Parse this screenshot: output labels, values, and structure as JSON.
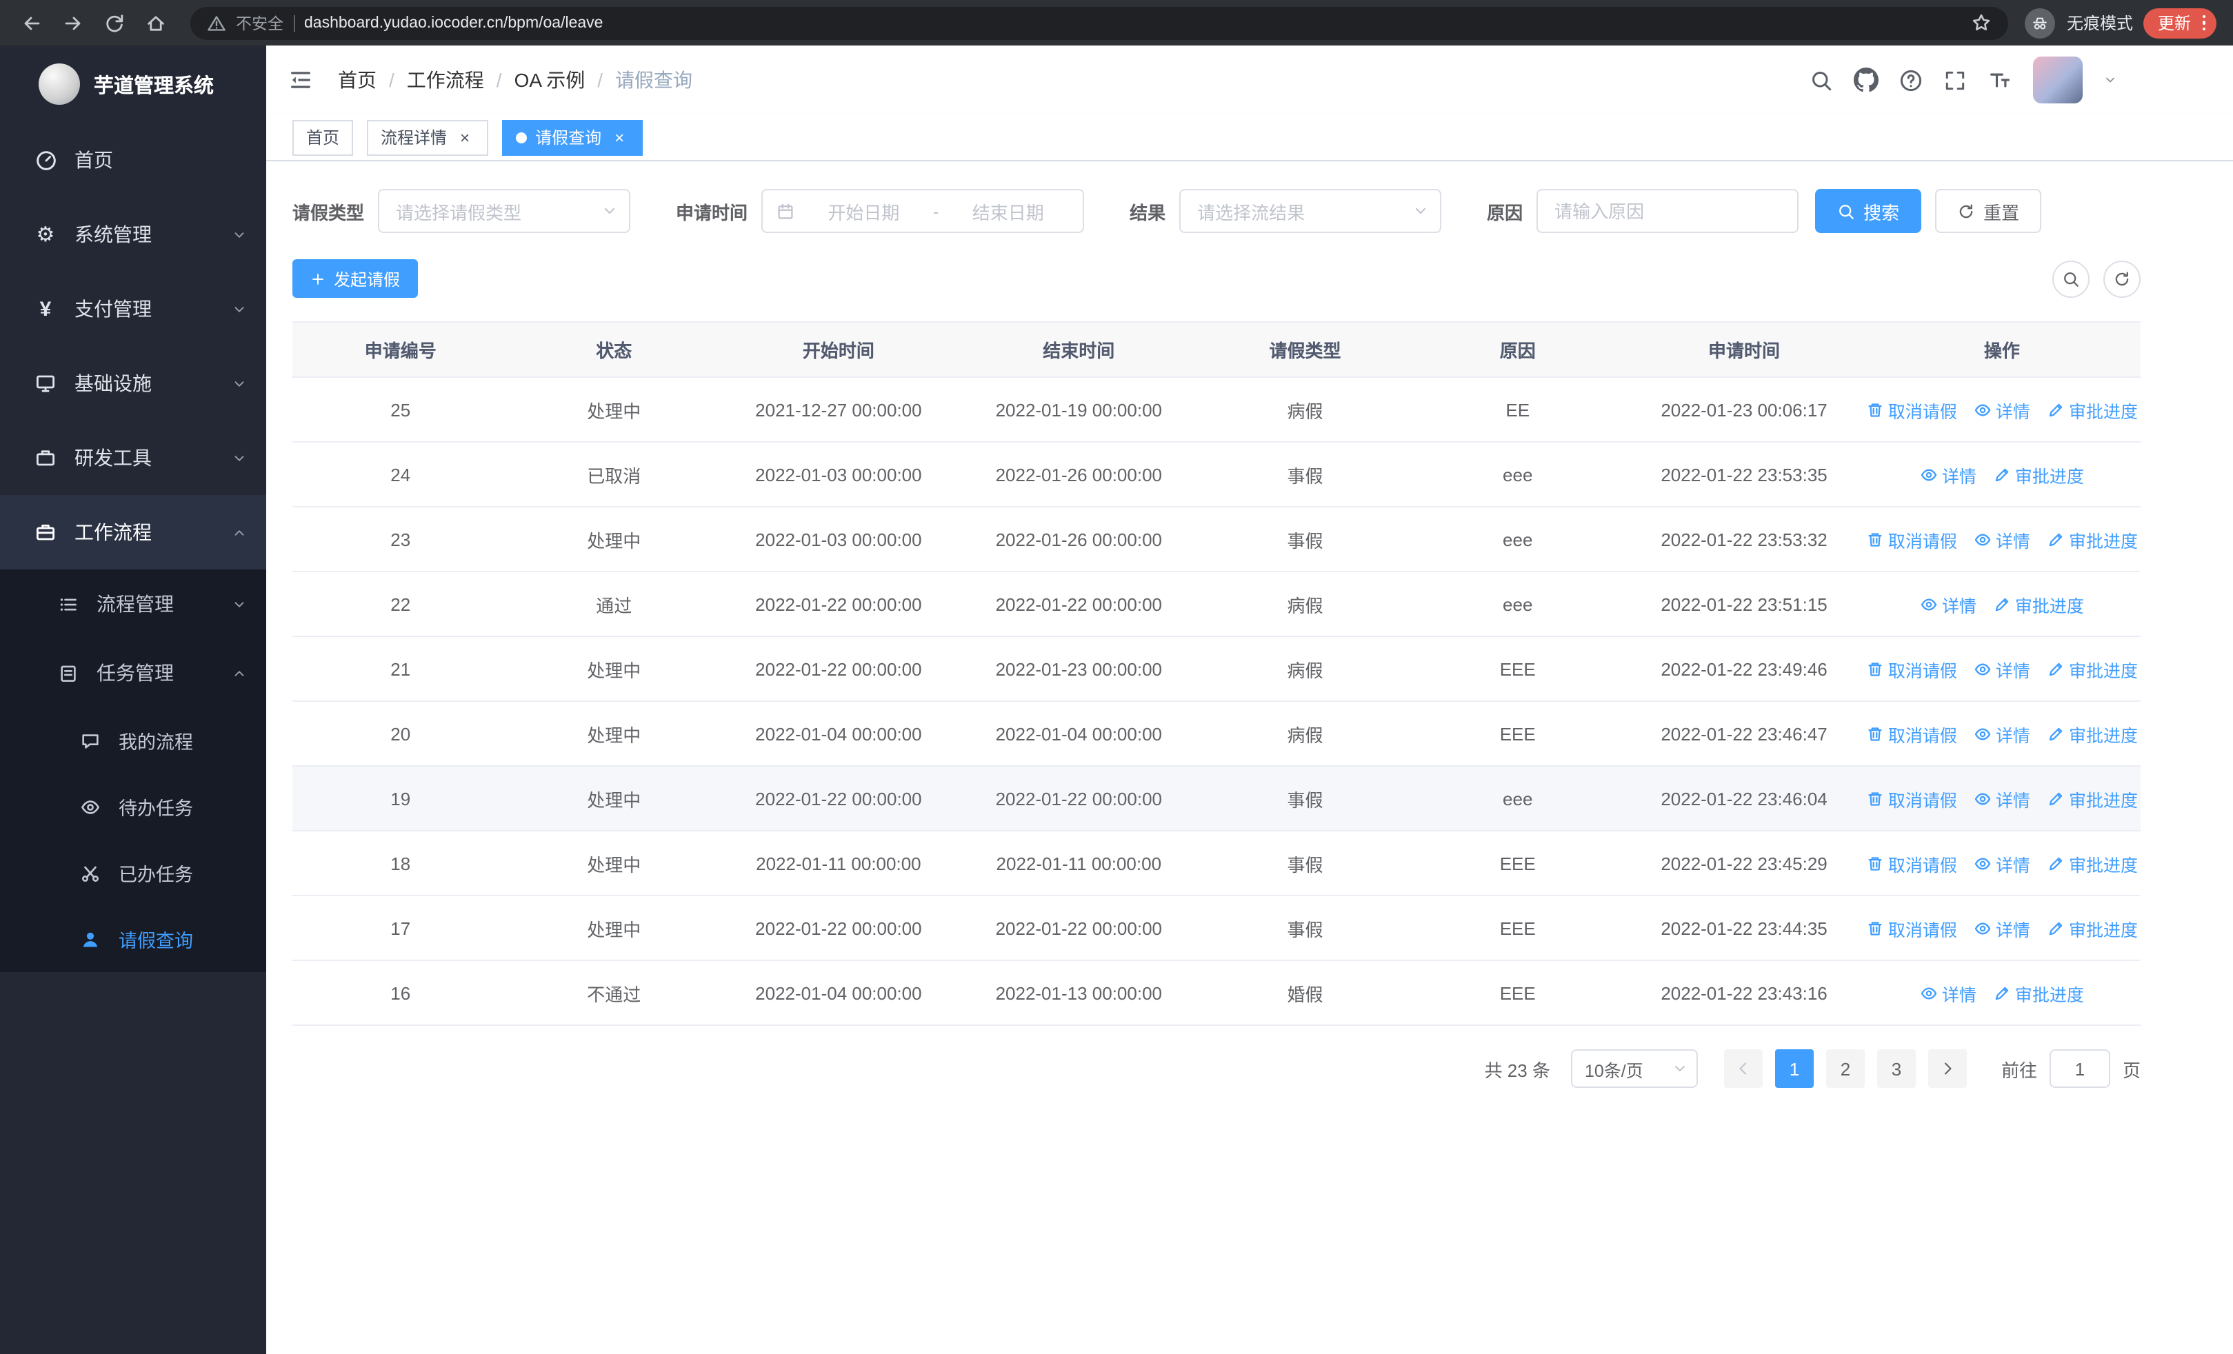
{
  "browser": {
    "security_label": "不安全",
    "url": "dashboard.yudao.iocoder.cn/bpm/oa/leave",
    "incognito_label": "无痕模式",
    "update_label": "更新"
  },
  "sidebar": {
    "logo_title": "芋道管理系统",
    "items": [
      {
        "label": "首页"
      },
      {
        "label": "系统管理"
      },
      {
        "label": "支付管理"
      },
      {
        "label": "基础设施"
      },
      {
        "label": "研发工具"
      },
      {
        "label": "工作流程"
      }
    ],
    "workflow_children": [
      {
        "label": "流程管理"
      },
      {
        "label": "任务管理"
      }
    ],
    "task_children": [
      {
        "label": "我的流程"
      },
      {
        "label": "待办任务"
      },
      {
        "label": "已办任务"
      },
      {
        "label": "请假查询"
      }
    ]
  },
  "header": {
    "breadcrumb": [
      "首页",
      "工作流程",
      "OA 示例",
      "请假查询"
    ]
  },
  "tabs": [
    {
      "label": "首页"
    },
    {
      "label": "流程详情"
    },
    {
      "label": "请假查询"
    }
  ],
  "filters": {
    "leave_type_label": "请假类型",
    "leave_type_placeholder": "请选择请假类型",
    "apply_time_label": "申请时间",
    "start_date_placeholder": "开始日期",
    "range_separator": "-",
    "end_date_placeholder": "结束日期",
    "result_label": "结果",
    "result_placeholder": "请选择流结果",
    "reason_label": "原因",
    "reason_placeholder": "请输入原因",
    "search_label": "搜索",
    "reset_label": "重置"
  },
  "toolbar": {
    "create_label": "发起请假"
  },
  "table": {
    "columns": [
      "申请编号",
      "状态",
      "开始时间",
      "结束时间",
      "请假类型",
      "原因",
      "申请时间",
      "操作"
    ],
    "action_labels": {
      "cancel": "取消请假",
      "detail": "详情",
      "progress": "审批进度"
    },
    "rows": [
      {
        "id": "25",
        "status": "处理中",
        "start": "2021-12-27 00:00:00",
        "end": "2022-01-19 00:00:00",
        "type": "病假",
        "reason": "EE",
        "apply_time": "2022-01-23 00:06:17",
        "cancelable": true,
        "highlighted": false
      },
      {
        "id": "24",
        "status": "已取消",
        "start": "2022-01-03 00:00:00",
        "end": "2022-01-26 00:00:00",
        "type": "事假",
        "reason": "eee",
        "apply_time": "2022-01-22 23:53:35",
        "cancelable": false,
        "highlighted": false
      },
      {
        "id": "23",
        "status": "处理中",
        "start": "2022-01-03 00:00:00",
        "end": "2022-01-26 00:00:00",
        "type": "事假",
        "reason": "eee",
        "apply_time": "2022-01-22 23:53:32",
        "cancelable": true,
        "highlighted": false
      },
      {
        "id": "22",
        "status": "通过",
        "start": "2022-01-22 00:00:00",
        "end": "2022-01-22 00:00:00",
        "type": "病假",
        "reason": "eee",
        "apply_time": "2022-01-22 23:51:15",
        "cancelable": false,
        "highlighted": false
      },
      {
        "id": "21",
        "status": "处理中",
        "start": "2022-01-22 00:00:00",
        "end": "2022-01-23 00:00:00",
        "type": "病假",
        "reason": "EEE",
        "apply_time": "2022-01-22 23:49:46",
        "cancelable": true,
        "highlighted": false
      },
      {
        "id": "20",
        "status": "处理中",
        "start": "2022-01-04 00:00:00",
        "end": "2022-01-04 00:00:00",
        "type": "病假",
        "reason": "EEE",
        "apply_time": "2022-01-22 23:46:47",
        "cancelable": true,
        "highlighted": false
      },
      {
        "id": "19",
        "status": "处理中",
        "start": "2022-01-22 00:00:00",
        "end": "2022-01-22 00:00:00",
        "type": "事假",
        "reason": "eee",
        "apply_time": "2022-01-22 23:46:04",
        "cancelable": true,
        "highlighted": true
      },
      {
        "id": "18",
        "status": "处理中",
        "start": "2022-01-11 00:00:00",
        "end": "2022-01-11 00:00:00",
        "type": "事假",
        "reason": "EEE",
        "apply_time": "2022-01-22 23:45:29",
        "cancelable": true,
        "highlighted": false
      },
      {
        "id": "17",
        "status": "处理中",
        "start": "2022-01-22 00:00:00",
        "end": "2022-01-22 00:00:00",
        "type": "事假",
        "reason": "EEE",
        "apply_time": "2022-01-22 23:44:35",
        "cancelable": true,
        "highlighted": false
      },
      {
        "id": "16",
        "status": "不通过",
        "start": "2022-01-04 00:00:00",
        "end": "2022-01-13 00:00:00",
        "type": "婚假",
        "reason": "EEE",
        "apply_time": "2022-01-22 23:43:16",
        "cancelable": false,
        "highlighted": false
      }
    ]
  },
  "pagination": {
    "total_label": "共 23 条",
    "page_size": "10条/页",
    "pages": [
      "1",
      "2",
      "3"
    ],
    "active_page": "1",
    "goto_label": "前往",
    "goto_value": "1",
    "page_label": "页"
  },
  "colors": {
    "primary": "#409eff",
    "sidebar_bg": "#232834",
    "submenu_bg": "#171b26",
    "chrome_bg": "#2e3136",
    "address_bar_bg": "#202124",
    "update_button": "#e2574c"
  }
}
